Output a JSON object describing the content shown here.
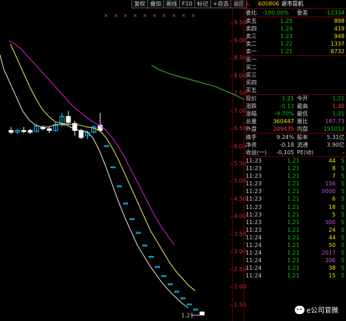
{
  "toolbar": [
    "复权",
    "叠加",
    "画线",
    "F10",
    "标记",
    "+自选",
    "返回"
  ],
  "header": {
    "market_flag": "L",
    "code": "600806",
    "name": "退市昆机"
  },
  "order_ratio": {
    "label1": "委比",
    "value1": "-100.00%",
    "label2": "委差",
    "value2": "-12334"
  },
  "asks": [
    {
      "label": "卖五",
      "price": "1.25",
      "vol": "898"
    },
    {
      "label": "卖四",
      "price": "1.24",
      "vol": "419"
    },
    {
      "label": "卖三",
      "price": "1.23",
      "vol": "948"
    },
    {
      "label": "卖二",
      "price": "1.22",
      "vol": "1337"
    },
    {
      "label": "卖一",
      "price": "1.21",
      "vol": "8732"
    }
  ],
  "bids": [
    {
      "label": "买一"
    },
    {
      "label": "买二"
    },
    {
      "label": "买三"
    },
    {
      "label": "买四"
    },
    {
      "label": "买五"
    }
  ],
  "quote": [
    {
      "l1": "现价",
      "v1": "1.21",
      "l2": "今开",
      "v2": "1.21",
      "c1": "green",
      "c2": "green"
    },
    {
      "l1": "涨跌",
      "v1": "-0.13",
      "l2": "最高",
      "v2": "1.30",
      "c1": "green",
      "c2": "red"
    },
    {
      "l1": "涨幅",
      "v1": "-9.70%",
      "l2": "最低",
      "v2": "1.21",
      "c1": "green",
      "c2": "green"
    },
    {
      "l1": "总量",
      "v1": "360447",
      "l2": "量比",
      "v2": "187.73",
      "c1": "yellow",
      "c2": "purple"
    },
    {
      "l1": "外盘",
      "v1": "209435",
      "l2": "内盘",
      "v2": "151012",
      "c1": "red",
      "c2": "green"
    }
  ],
  "fundamentals": [
    {
      "l1": "换手",
      "v1": "9.24%",
      "l2": "股本",
      "v2": "5.31亿"
    },
    {
      "l1": "净资",
      "v1": "-0.18",
      "l2": "流通",
      "v2": "3.90亿"
    },
    {
      "l1": "收益(一)",
      "v1": "-0.105",
      "l2": "PE(动)",
      "v2": "-"
    }
  ],
  "ticks": [
    {
      "time": "11:23",
      "price": "1.21",
      "vol": "44",
      "side": "S"
    },
    {
      "time": "11:23",
      "price": "1.21",
      "vol": "8",
      "side": "S"
    },
    {
      "time": "11:23",
      "price": "1.21",
      "vol": "7",
      "side": "S"
    },
    {
      "time": "11:23",
      "price": "1.21",
      "vol": "156",
      "side": "S"
    },
    {
      "time": "11:23",
      "price": "1.21",
      "vol": "5000",
      "side": "S"
    },
    {
      "time": "11:23",
      "price": "1.21",
      "vol": "6",
      "side": "S"
    },
    {
      "time": "11:23",
      "price": "1.21",
      "vol": "18",
      "side": "S"
    },
    {
      "time": "11:23",
      "price": "1.21",
      "vol": "5",
      "side": "S"
    },
    {
      "time": "11:23",
      "price": "1.21",
      "vol": "500",
      "side": "S"
    },
    {
      "time": "11:23",
      "price": "1.21",
      "vol": "24",
      "side": "S"
    },
    {
      "time": "11:24",
      "price": "1.21",
      "vol": "44",
      "side": "S"
    },
    {
      "time": "11:24",
      "price": "1.21",
      "vol": "50",
      "side": "S"
    },
    {
      "time": "11:24",
      "price": "1.21",
      "vol": "2017",
      "side": "S"
    },
    {
      "time": "11:24",
      "price": "1.21",
      "vol": "206",
      "side": "S"
    },
    {
      "time": "11:24",
      "price": "1.21",
      "vol": "38",
      "side": "S"
    },
    {
      "time": "11:24",
      "price": "1.21",
      "vol": "15",
      "side": "S"
    }
  ],
  "axis": [
    "9.50",
    "9.00",
    "8.50",
    "8.00",
    "7.50",
    "7.00",
    "6.50",
    "6.00",
    "5.50",
    "5.00",
    "4.50",
    "4.00",
    "3.50",
    "3.00",
    "2.50",
    "2.00",
    "1.50"
  ],
  "last_price_label": "1.21",
  "watermark": "e公司官微",
  "colors": {
    "ma1": "#e0e0e0",
    "ma2": "#e8e860",
    "ma3": "#d020d0",
    "ma4": "#30c030",
    "up": "#00d0ff",
    "down": "#ffffff"
  },
  "chart_data": {
    "type": "candlestick",
    "ylim": [
      1.2,
      9.8
    ],
    "candles": [
      {
        "o": 6.45,
        "h": 6.55,
        "l": 6.35,
        "c": 6.4
      },
      {
        "o": 6.4,
        "h": 6.5,
        "l": 6.35,
        "c": 6.45
      },
      {
        "o": 6.45,
        "h": 6.55,
        "l": 6.38,
        "c": 6.42
      },
      {
        "o": 6.45,
        "h": 6.5,
        "l": 6.35,
        "c": 6.4
      },
      {
        "o": 6.42,
        "h": 6.65,
        "l": 6.4,
        "c": 6.58
      },
      {
        "o": 6.55,
        "h": 6.6,
        "l": 6.45,
        "c": 6.5
      },
      {
        "o": 6.5,
        "h": 6.55,
        "l": 6.38,
        "c": 6.45
      },
      {
        "o": 6.45,
        "h": 6.7,
        "l": 6.42,
        "c": 6.62
      },
      {
        "o": 6.62,
        "h": 6.95,
        "l": 6.55,
        "c": 6.85
      },
      {
        "o": 6.85,
        "h": 7.0,
        "l": 6.62,
        "c": 6.68
      },
      {
        "o": 6.65,
        "h": 6.72,
        "l": 6.3,
        "c": 6.45
      },
      {
        "o": 6.45,
        "h": 6.5,
        "l": 6.2,
        "c": 6.25
      },
      {
        "o": 6.3,
        "h": 6.45,
        "l": 6.2,
        "c": 6.4
      },
      {
        "o": 6.4,
        "h": 6.6,
        "l": 6.38,
        "c": 6.55
      },
      {
        "o": 6.6,
        "h": 6.95,
        "l": 6.4,
        "c": 6.45
      },
      {
        "o": 6.02,
        "h": 6.02,
        "l": 6.02,
        "c": 6.02
      },
      {
        "o": 5.42,
        "h": 5.42,
        "l": 5.42,
        "c": 5.42
      },
      {
        "o": 4.88,
        "h": 4.88,
        "l": 4.88,
        "c": 4.88
      },
      {
        "o": 4.39,
        "h": 4.39,
        "l": 4.39,
        "c": 4.39
      },
      {
        "o": 3.95,
        "h": 3.95,
        "l": 3.95,
        "c": 3.95
      },
      {
        "o": 3.56,
        "h": 3.56,
        "l": 3.56,
        "c": 3.56
      },
      {
        "o": 3.2,
        "h": 3.2,
        "l": 3.2,
        "c": 3.2
      },
      {
        "o": 2.88,
        "h": 2.88,
        "l": 2.88,
        "c": 2.88
      },
      {
        "o": 2.59,
        "h": 2.59,
        "l": 2.59,
        "c": 2.59
      },
      {
        "o": 2.33,
        "h": 2.33,
        "l": 2.33,
        "c": 2.33
      },
      {
        "o": 2.1,
        "h": 2.1,
        "l": 2.1,
        "c": 2.1
      },
      {
        "o": 1.89,
        "h": 1.89,
        "l": 1.89,
        "c": 1.89
      },
      {
        "o": 1.7,
        "h": 1.7,
        "l": 1.7,
        "c": 1.7
      },
      {
        "o": 1.53,
        "h": 1.53,
        "l": 1.53,
        "c": 1.53
      },
      {
        "o": 1.38,
        "h": 1.38,
        "l": 1.38,
        "c": 1.38
      },
      {
        "o": 1.3,
        "h": 1.3,
        "l": 1.21,
        "c": 1.21
      }
    ],
    "ma_lines": [
      {
        "color": "#e0e0e0",
        "values": [
          8.6,
          8.2,
          7.8,
          7.4,
          7.0,
          6.75,
          6.6,
          6.55,
          6.55,
          6.6,
          6.62,
          6.6,
          6.5,
          6.45,
          6.42,
          6.25,
          5.9,
          5.45,
          4.95,
          4.45,
          4.0,
          3.6,
          3.2,
          2.9,
          2.6,
          2.35,
          2.1,
          1.9,
          1.72,
          1.55,
          1.42
        ]
      },
      {
        "color": "#e8e860",
        "values": [
          null,
          8.9,
          8.5,
          8.1,
          7.7,
          7.35,
          7.05,
          6.85,
          6.7,
          6.65,
          6.63,
          6.62,
          6.6,
          6.55,
          6.52,
          6.45,
          6.25,
          5.95,
          5.6,
          5.2,
          4.8,
          4.4,
          4.0,
          3.6,
          3.3,
          3.0,
          2.7,
          2.45,
          2.25,
          2.05,
          1.9
        ]
      },
      {
        "color": "#d020d0",
        "values": [
          9.0,
          8.9,
          8.75,
          8.55,
          8.35,
          8.15,
          7.95,
          7.75,
          7.55,
          7.35,
          7.15,
          7.0,
          6.85,
          6.72,
          6.62,
          6.5,
          6.3,
          6.05,
          5.75,
          5.4,
          5.05,
          4.7,
          4.35,
          4.0,
          3.7,
          3.45,
          3.2
        ]
      },
      {
        "color": "#30c030",
        "values": [
          8.3,
          8.2,
          8.12,
          8.05,
          8.0,
          7.95,
          7.9,
          7.85,
          7.8,
          7.75,
          7.7,
          7.62,
          7.55,
          7.47,
          7.38,
          7.28,
          7.18,
          7.05,
          6.92,
          6.78,
          6.62,
          6.45
        ]
      }
    ]
  }
}
